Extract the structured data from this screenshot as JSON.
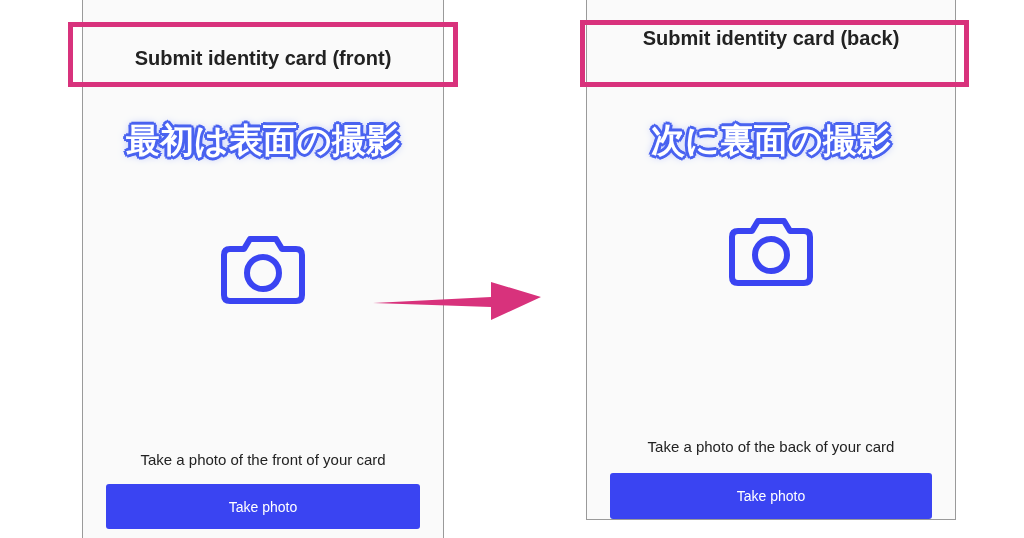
{
  "panels": [
    {
      "title": "Submit identity card (front)",
      "caption": "最初は表面の撮影",
      "prompt": "Take a photo of the front of your card",
      "button": "Take photo"
    },
    {
      "title": "Submit identity card (back)",
      "caption": "次に裏面の撮影",
      "prompt": "Take a photo of the back of your card",
      "button": "Take photo"
    }
  ]
}
